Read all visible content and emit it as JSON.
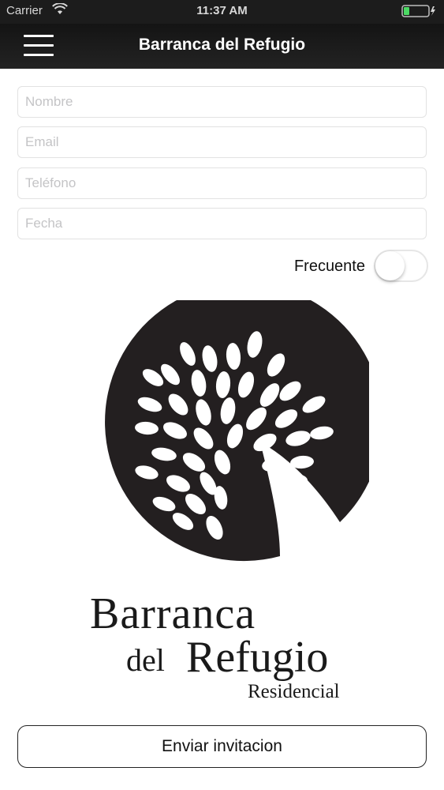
{
  "status_bar": {
    "carrier": "Carrier",
    "time": "11:37 AM"
  },
  "nav": {
    "title": "Barranca del Refugio",
    "menu_icon": "hamburger-menu-icon"
  },
  "form": {
    "nombre_placeholder": "Nombre",
    "email_placeholder": "Email",
    "telefono_placeholder": "Teléfono",
    "fecha_placeholder": "Fecha",
    "frecuente_label": "Frecuente",
    "frecuente_on": false
  },
  "brand": {
    "line1": "Barranca",
    "line2a": "del",
    "line2b": "Refugio",
    "line3": "Residencial"
  },
  "actions": {
    "send_label": "Enviar invitacion"
  },
  "colors": {
    "nav_background": "#1c1c1c",
    "logo": "#231f20",
    "battery": "#4cd964"
  }
}
